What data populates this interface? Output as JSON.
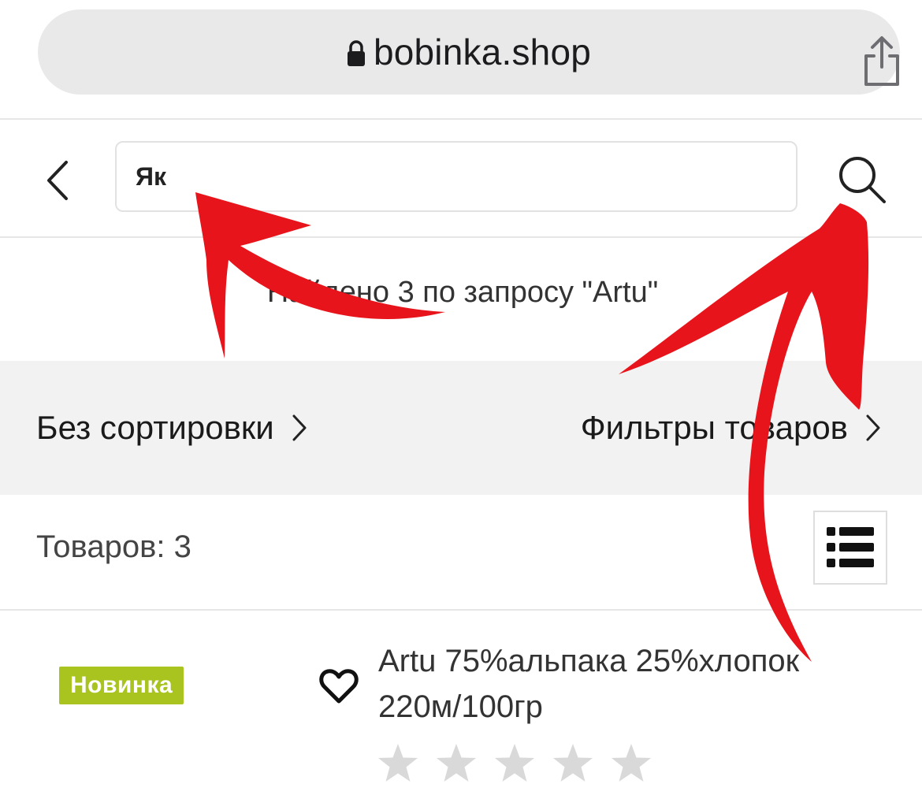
{
  "browser": {
    "url": "bobinka.shop"
  },
  "search": {
    "value": "Як"
  },
  "results": {
    "found_text": "Найдено 3 по запросу \"Artu\""
  },
  "toolbar": {
    "sort_label": "Без сортировки",
    "filter_label": "Фильтры товаров"
  },
  "listing": {
    "count_text": "Товаров: 3"
  },
  "product": {
    "badge": "Новинка",
    "title_line1": "Artu 75%альпака 25%хлопок",
    "title_line2": "220м/100гр",
    "rating": 0,
    "rating_max": 5
  },
  "colors": {
    "badge": "#a9c41e",
    "annotation": "#e8141b",
    "star_empty": "#d9d9d9"
  },
  "icons": [
    "lock-icon",
    "share-icon",
    "back-icon",
    "search-icon",
    "chevron-right-icon",
    "list-view-icon",
    "heart-icon",
    "star-icon"
  ]
}
